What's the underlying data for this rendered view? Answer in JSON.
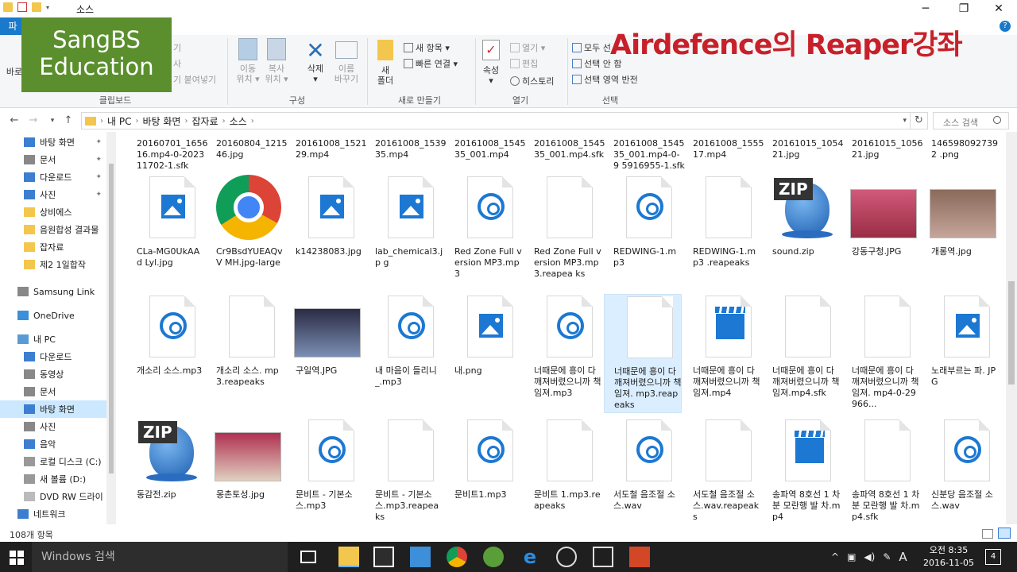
{
  "window": {
    "title": "소스",
    "controls": {
      "minimize": "─",
      "maximize": "❐",
      "close": "✕"
    }
  },
  "ribbon": {
    "file_tab": "파",
    "help": "?",
    "clipboard": {
      "paste_label": "바로",
      "faded_items": [
        "기",
        "사",
        "기 붙여넣기"
      ],
      "group": "클립보드"
    },
    "organize": {
      "move": "이동\n위치 ▾",
      "copy": "복사\n위치 ▾",
      "delete": "삭제\n▾",
      "rename": "이름\n바꾸기",
      "group": "구성"
    },
    "new": {
      "new_folder": "새\n폴더",
      "new_item": "새 항목 ▾",
      "easy_access": "빠른 연결 ▾",
      "group": "새로 만들기"
    },
    "open": {
      "properties": "속성\n▾",
      "open": "열기 ▾",
      "edit": "편집",
      "history": "히스토리",
      "group": "열기"
    },
    "select": {
      "select_all": "모두 선",
      "select_none": "선택 안 함",
      "invert": "선택 영역 반전",
      "group": "선택"
    }
  },
  "overlay": {
    "sangbs_line1": "SangBS",
    "sangbs_line2": "Education",
    "airdefence": "Airdefence의 Reaper강좌"
  },
  "address": {
    "crumbs": [
      "내 PC",
      "바탕 화면",
      "잡자료",
      "소스"
    ],
    "search_placeholder": "소스 검색"
  },
  "nav": {
    "items": [
      {
        "label": "바탕 화면",
        "pinned": true
      },
      {
        "label": "문서",
        "pinned": true
      },
      {
        "label": "다운로드",
        "pinned": true
      },
      {
        "label": "사진",
        "pinned": true
      },
      {
        "label": "상비에스",
        "pinned": false
      },
      {
        "label": "음원합성 결과물",
        "pinned": false
      },
      {
        "label": "잡자료",
        "pinned": false
      },
      {
        "label": "제2 1일합작",
        "pinned": false
      },
      {
        "label": "Samsung Link",
        "pinned": false
      },
      {
        "label": "OneDrive",
        "pinned": false
      },
      {
        "label": "내 PC",
        "pinned": false
      },
      {
        "label": "다운로드",
        "pinned": false
      },
      {
        "label": "동영상",
        "pinned": false
      },
      {
        "label": "문서",
        "pinned": false
      },
      {
        "label": "바탕 화면",
        "pinned": false
      },
      {
        "label": "사진",
        "pinned": false
      },
      {
        "label": "음악",
        "pinned": false
      },
      {
        "label": "로컬 디스크 (C:)",
        "pinned": false
      },
      {
        "label": "새 볼륨 (D:)",
        "pinned": false
      },
      {
        "label": "DVD RW 드라이",
        "pinned": false
      },
      {
        "label": "네트워크",
        "pinned": false
      }
    ]
  },
  "files": {
    "top_row": [
      "20160701_1656 16.mp4-0-2023 11702-1.sfk",
      "20160804_1215 46.jpg",
      "20161008_1521 29.mp4",
      "20161008_1539 35.mp4",
      "20161008_1545 35_001.mp4",
      "20161008_1545 35_001.mp4.sfk",
      "20161008_1545 35_001.mp4-0-9 5916955-1.sfk",
      "20161008_1555 17.mp4",
      "20161015_1054 21.jpg",
      "20161015_1056 21.jpg",
      "1465980927392 .png"
    ],
    "row1": [
      {
        "name": "CLa-MG0UkAAd Lyl.jpg",
        "icon": "image-icon"
      },
      {
        "name": "Cr9BsdYUEAQvV MH.jpg-large",
        "icon": "chrome-icon"
      },
      {
        "name": "k14238083.jpg",
        "icon": "image-icon"
      },
      {
        "name": "lab_chemical3.jp g",
        "icon": "image-icon"
      },
      {
        "name": "Red Zone Full version MP3.mp3",
        "icon": "audio-icon"
      },
      {
        "name": "Red Zone Full version MP3.mp3.reapea ks",
        "icon": "blank-file-icon"
      },
      {
        "name": "REDWING-1.mp3",
        "icon": "audio-icon"
      },
      {
        "name": "REDWING-1.mp3 .reapeaks",
        "icon": "blank-file-icon"
      },
      {
        "name": "sound.zip",
        "icon": "zip-icon"
      },
      {
        "name": "강동구청.JPG",
        "icon": "photo-icon"
      },
      {
        "name": "개롱역.jpg",
        "icon": "photo-icon"
      }
    ],
    "row2": [
      {
        "name": "개소리 소스.mp3",
        "icon": "audio-icon"
      },
      {
        "name": "개소리 소스. mp3.reapeaks",
        "icon": "blank-file-icon"
      },
      {
        "name": "구일역.JPG",
        "icon": "photo-icon"
      },
      {
        "name": "내 마음이 들리니 _.mp3",
        "icon": "audio-icon"
      },
      {
        "name": "내.png",
        "icon": "image-icon"
      },
      {
        "name": "너때문에 흥이 다 깨져버렸으니까 책임져.mp3",
        "icon": "audio-icon"
      },
      {
        "name": "너때문에 흥이 다 깨져버렸으니까 책임져. mp3.reapeaks",
        "icon": "blank-file-icon",
        "selected": true
      },
      {
        "name": "너때문에 흥이 다 깨져버렸으니까 책임져.mp4",
        "icon": "video-icon"
      },
      {
        "name": "너때문에 흥이 다 깨져버렸으니까 책임져.mp4.sfk",
        "icon": "blank-file-icon"
      },
      {
        "name": "너때문에 흥이 다 깨져버렸으니까 책임져. mp4-0-29966...",
        "icon": "blank-file-icon"
      },
      {
        "name": "노래부르는 파. JPG",
        "icon": "image-icon"
      }
    ],
    "row3": [
      {
        "name": "동감전.zip",
        "icon": "zip-icon"
      },
      {
        "name": "몽촌토성.jpg",
        "icon": "photo-icon"
      },
      {
        "name": "문비트 - 기본소 스.mp3",
        "icon": "audio-icon"
      },
      {
        "name": "문비트 - 기본소 스.mp3.reapeaks",
        "icon": "blank-file-icon"
      },
      {
        "name": "문비트1.mp3",
        "icon": "audio-icon"
      },
      {
        "name": "문비트 1.mp3.reapeaks",
        "icon": "blank-file-icon"
      },
      {
        "name": "서도철 음조절 소 스.wav",
        "icon": "audio-icon"
      },
      {
        "name": "서도철 음조절 소 스.wav.reapeaks",
        "icon": "blank-file-icon"
      },
      {
        "name": "송파역 8호선 1 차분 모란행 발 차.mp4",
        "icon": "video-icon"
      },
      {
        "name": "송파역 8호선 1 차분 모란행 발 차.mp4.sfk",
        "icon": "blank-file-icon"
      },
      {
        "name": "신분당 음조절 소 스.wav",
        "icon": "audio-icon"
      }
    ]
  },
  "status": {
    "count": "108개 항목"
  },
  "taskbar": {
    "search": "Windows 검색",
    "clock_time": "오전 8:35",
    "clock_date": "2016-11-05",
    "notifications": "4",
    "ime": "A"
  },
  "colors": {
    "accent": "#1979ca",
    "selection": "#cce8ff",
    "icon_blue": "#1c78d2",
    "sangbs_bg": "#5b8f2e",
    "airdefence_red": "#c8202a"
  }
}
